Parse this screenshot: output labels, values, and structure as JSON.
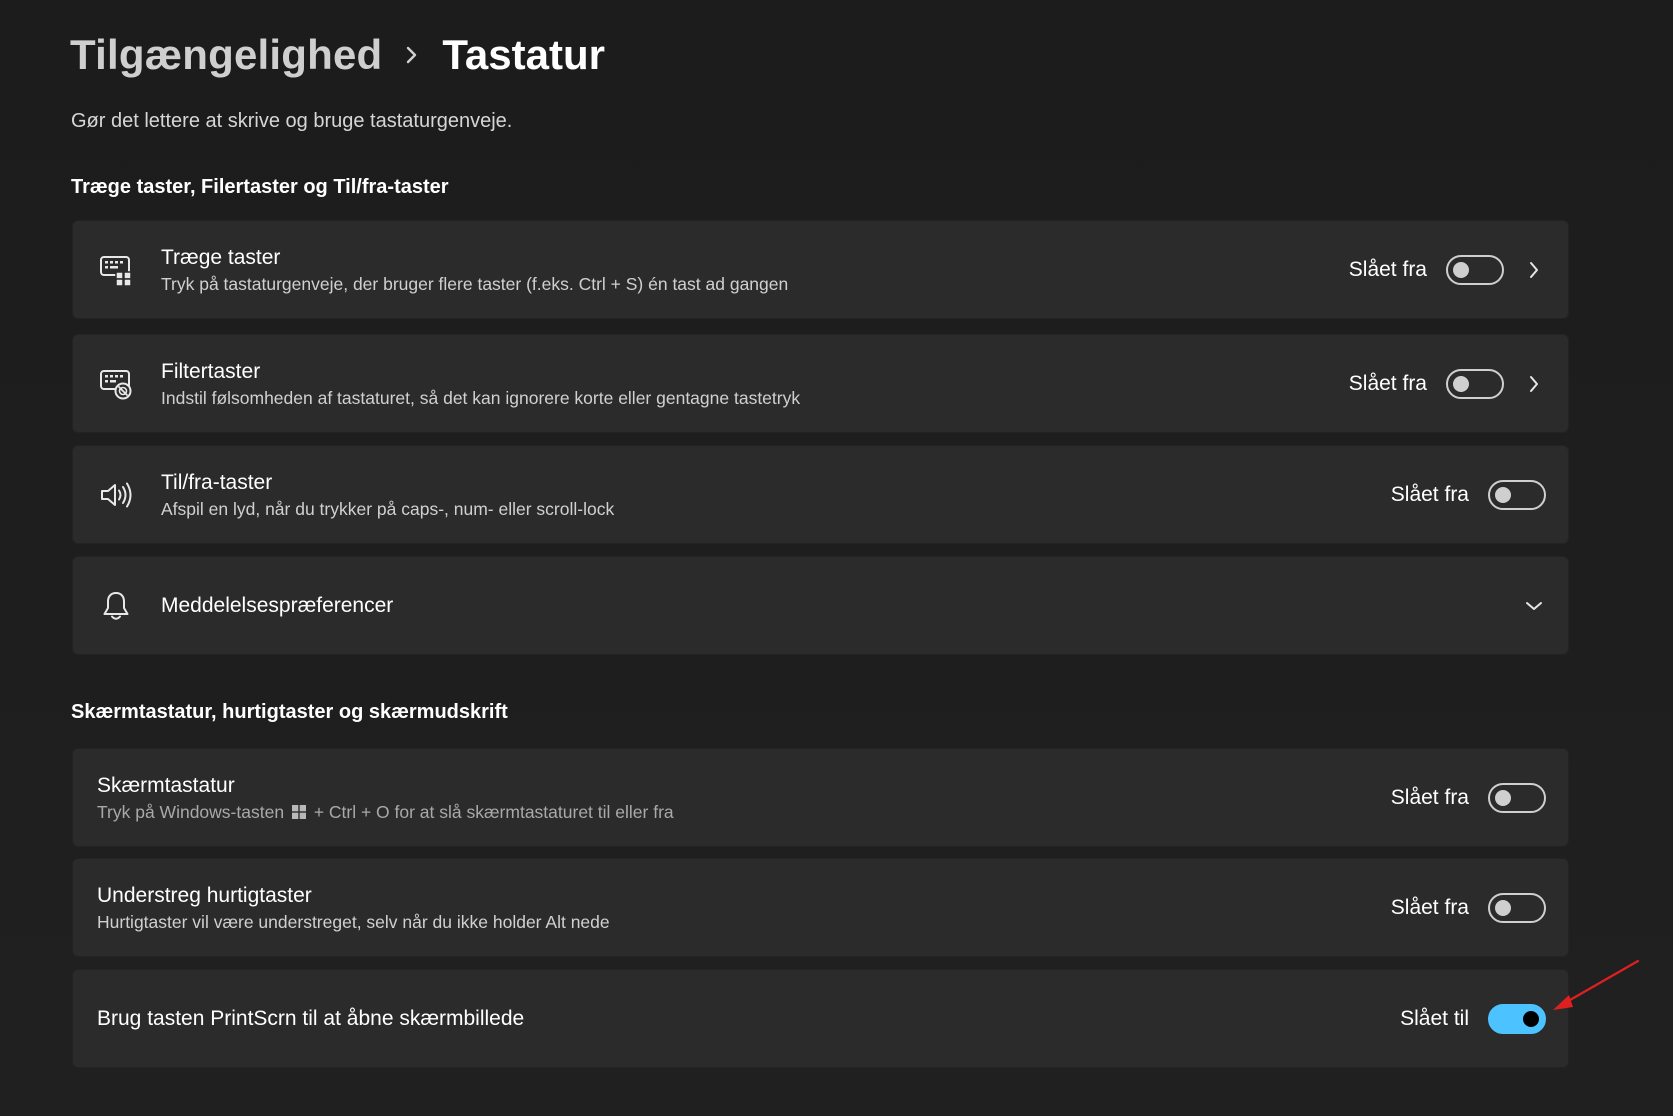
{
  "breadcrumb": {
    "parent": "Tilgængelighed",
    "current": "Tastatur"
  },
  "subtitle": "Gør det lettere at skrive og bruge tastaturgenveje.",
  "sections": [
    {
      "title": "Træge taster, Filertaster og Til/fra-taster",
      "items": [
        {
          "icon": "sticky-keys-icon",
          "title": "Træge taster",
          "desc": "Tryk på tastaturgenveje, der bruger flere taster (f.eks. Ctrl + S) én tast ad gangen",
          "state": "Slået fra",
          "on": false,
          "chevron": "right"
        },
        {
          "icon": "filter-keys-icon",
          "title": "Filtertaster",
          "desc": "Indstil følsomheden af tastaturet, så det kan ignorere korte eller gentagne tastetryk",
          "state": "Slået fra",
          "on": false,
          "chevron": "right"
        },
        {
          "icon": "speaker-icon",
          "title": "Til/fra-taster",
          "desc": "Afspil en lyd, når du trykker på caps-, num- eller scroll-lock",
          "state": "Slået fra",
          "on": false
        },
        {
          "icon": "bell-icon",
          "title": "Meddelelsespræferencer",
          "chevron": "down"
        }
      ]
    },
    {
      "title": "Skærmtastatur, hurtigtaster og skærmudskrift",
      "items": [
        {
          "title": "Skærmtastatur",
          "desc_before": "Tryk på Windows-tasten",
          "desc_icon": "windows-logo-icon",
          "desc_after": "+ Ctrl + O for at slå skærmtastaturet til eller fra",
          "state": "Slået fra",
          "on": false
        },
        {
          "title": "Understreg hurtigtaster",
          "desc": "Hurtigtaster vil være understreget, selv når du ikke holder Alt nede",
          "state": "Slået fra",
          "on": false
        },
        {
          "title": "Brug tasten PrintScrn til at åbne skærmbillede",
          "state": "Slået til",
          "on": true
        }
      ]
    }
  ],
  "colors": {
    "accent": "#4cc2ff",
    "annotation": "#e02020",
    "card": "#2b2b2b",
    "background": "#1f1f1f"
  },
  "annotation": "red-arrow-icon"
}
